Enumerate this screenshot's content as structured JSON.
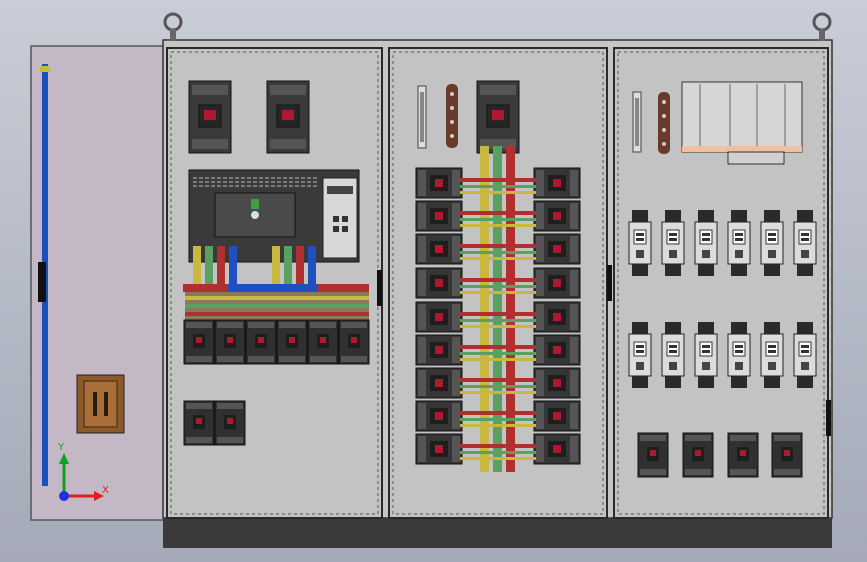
{
  "viewport": {
    "background_top": "#c9cdd7",
    "background_bottom": "#a5aab8"
  },
  "colors": {
    "cabinet_body": "#c6c6c6",
    "cabinet_edge": "#3a3a3a",
    "plinth": "#3a3a3a",
    "door_panel": "#c5b8c6",
    "door_handle": "#1a4fc0",
    "component_dark": "#2e2e2e",
    "breaker_red": "#b01830",
    "busbar_yellow": "#c8b840",
    "busbar_green": "#5aa060",
    "busbar_red": "#b03030",
    "busbar_blue": "#2050c0",
    "copper_terminal": "#6a3a2a",
    "axis_x": "#e02020",
    "axis_y": "#10a020",
    "axis_z": "#2030e0"
  },
  "triad": {
    "x_label": "X",
    "y_label": "Y",
    "icons": [
      "axis-x-arrow-icon",
      "axis-y-arrow-icon",
      "axis-z-dot-icon"
    ]
  },
  "cabinet": {
    "sections": [
      "left-section",
      "middle-section",
      "right-section"
    ],
    "lifting_eyes": 2
  }
}
